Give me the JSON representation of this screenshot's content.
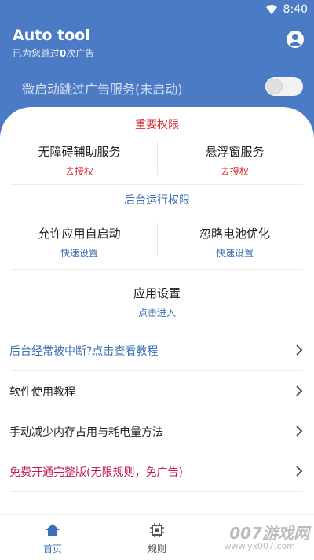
{
  "status": {
    "time": "8:40"
  },
  "header": {
    "title": "Auto tool",
    "subtitle_prefix": "已为您跳过",
    "skip_count": "0",
    "subtitle_suffix": "次广告"
  },
  "service": {
    "label": "微启动跳过广告服务(未启动)",
    "enabled": false
  },
  "important": {
    "title": "重要权限",
    "items": [
      {
        "name": "无障碍辅助服务",
        "action": "去授权"
      },
      {
        "name": "悬浮窗服务",
        "action": "去授权"
      }
    ]
  },
  "background": {
    "title": "后台运行权限",
    "items": [
      {
        "name": "允许应用自启动",
        "action": "快速设置"
      },
      {
        "name": "忽略电池优化",
        "action": "快速设置"
      }
    ]
  },
  "app_settings": {
    "name": "应用设置",
    "action": "点击进入"
  },
  "list": [
    {
      "label": "后台经常被中断?点击查看教程",
      "color": "#3a6fb5"
    },
    {
      "label": "软件使用教程",
      "color": "#222222"
    },
    {
      "label": "手动减少内存占用与耗电量方法",
      "color": "#222222"
    },
    {
      "label": "免费开通完整版(无限规则，免广告)",
      "color": "#c2185b"
    }
  ],
  "nav": [
    {
      "label": "首页",
      "active": true
    },
    {
      "label": "规则",
      "active": false
    }
  ],
  "watermark": {
    "main": "007游戏网",
    "sub": "www.yx007.com"
  },
  "colors": {
    "primary": "#4a7bc4",
    "danger": "#d32f2f",
    "link": "#3a6fb5",
    "pink": "#c2185b"
  }
}
